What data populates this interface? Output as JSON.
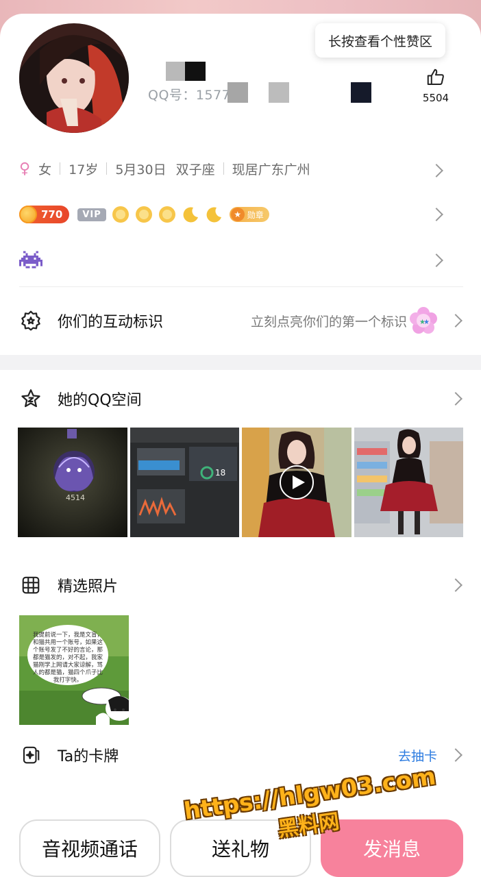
{
  "profile": {
    "qq_label": "QQ号：1577",
    "like_tooltip": "长按查看个性赞区",
    "like_count": "5504"
  },
  "info": {
    "gender_icon": "female-icon",
    "gender": "女",
    "age": "17岁",
    "birthday": "5月30日",
    "zodiac": "双子座",
    "location": "现居广东广州"
  },
  "badges": {
    "coin_value": "770",
    "vip_label": "VIP",
    "medal_label": "勋章"
  },
  "interaction": {
    "title": "你们的互动标识",
    "hint": "立刻点亮你们的第一个标识"
  },
  "qzone": {
    "title": "她的QQ空间",
    "thumb1_caption": "4514"
  },
  "photos": {
    "title": "精选照片",
    "speech_text": "我提前说一下，我是文盲，和猫共用一个账号，如果这个账号发了不好的言论，那都是猫发的，对不起，我家猫刚学上网请大家谅解，骂人的都是猫，猫四个爪子比我打字快。"
  },
  "cards": {
    "title": "Ta的卡牌",
    "action": "去抽卡"
  },
  "actions": {
    "call": "音视频通话",
    "gift": "送礼物",
    "message": "发消息"
  },
  "watermark": {
    "line1": "https://hlgw03.com",
    "line2": "黑料网"
  },
  "colors": {
    "accent_pink": "#f7829c",
    "link_blue": "#2b7be0",
    "female_pink": "#e77fb4"
  }
}
